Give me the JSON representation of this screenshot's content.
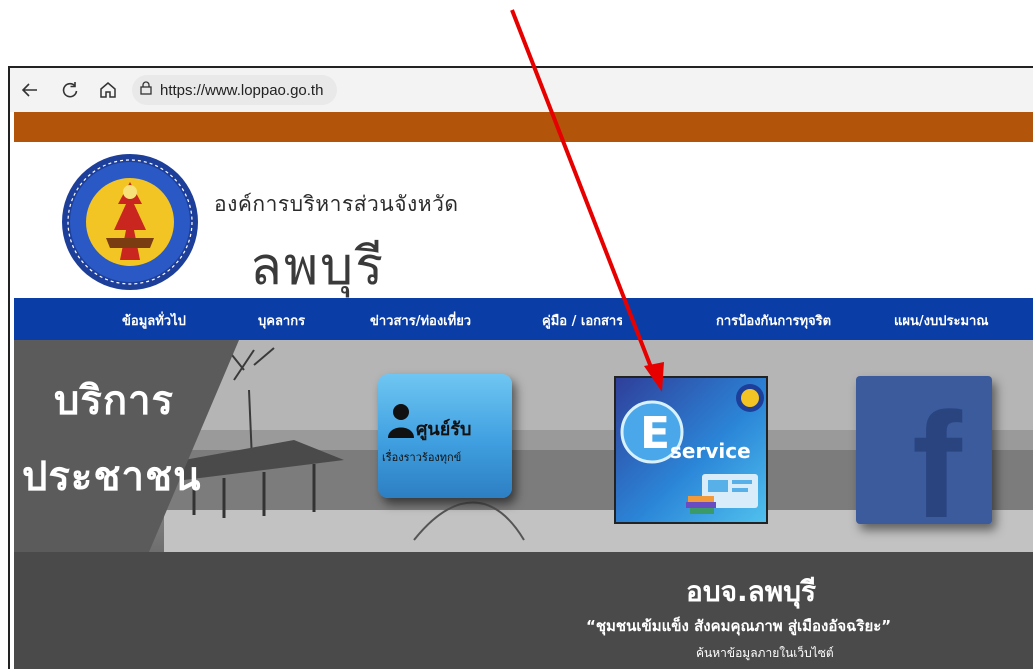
{
  "browser": {
    "url": "https://www.loppao.go.th",
    "icons": [
      "back-arrow-icon",
      "reload-icon",
      "home-icon",
      "site-info-icon"
    ]
  },
  "header": {
    "org_line1": "องค์การบริหารส่วนจังหวัด",
    "org_line2": "ลพบุรี"
  },
  "nav": {
    "items": [
      {
        "label": "ข้อมูลทั่วไป"
      },
      {
        "label": "บุคลากร"
      },
      {
        "label": "ข่าวสาร/ท่องเที่ยว"
      },
      {
        "label": "คู่มือ / เอกสาร"
      },
      {
        "label": "การป้องกันการทุจริต"
      },
      {
        "label": "แผน/งบประมาณ"
      }
    ]
  },
  "banner": {
    "title_line1": "บริการ",
    "title_line2": "ประชาชน",
    "tiles": {
      "complaint_line1": "ศูนย์รับ",
      "complaint_line2": "เรื่องราวร้องทุกข์",
      "eservice_letter": "E",
      "eservice_label": "service"
    }
  },
  "footer": {
    "site_name": "อบจ.ลพบุรี",
    "slogan": "“ชุมชนเข้มแข็ง สังคมคุณภาพ สู่เมืองอัจฉริยะ”",
    "search_hint": "ค้นหาข้อมูลภายในเว็บไซต์"
  },
  "colors": {
    "orange_bar": "#b3540b",
    "nav_blue": "#0a3ea6",
    "annotation_arrow": "#e60000"
  }
}
